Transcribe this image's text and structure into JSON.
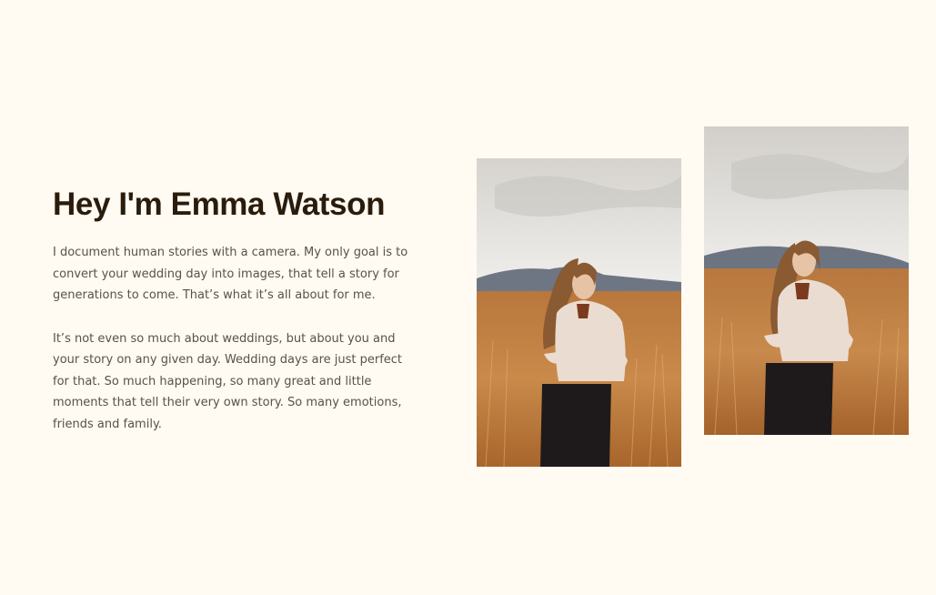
{
  "about": {
    "heading": "Hey I'm Emma Watson",
    "paragraph_1": "I document human stories with a camera. My only goal is to convert your wedding day into images, that tell a story for generations to come. That’s what it’s all about for me.",
    "paragraph_2": "It’s not even so much about weddings, but about you and your story on any given day. Wedding days are just perfect for that. So much happening, so many great and little moments that tell their very own story. So many emotions, friends and family."
  },
  "colors": {
    "background": "#fffaf2",
    "heading": "#2a1c0c",
    "body_text": "#5b5149"
  },
  "photos": [
    {
      "name": "portrait-photo-1"
    },
    {
      "name": "portrait-photo-2"
    }
  ]
}
